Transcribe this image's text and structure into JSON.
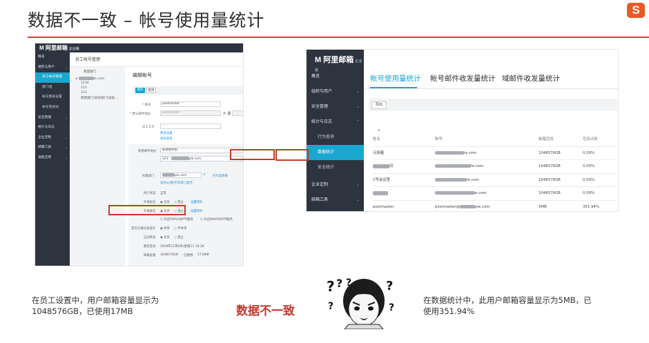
{
  "slide": {
    "title": "数据不一致 – 帐号使用量统计",
    "mid_label": "数据不一致",
    "caption_left": "在员工设置中，用户邮箱容量显示为1048576GB，已使用17MB",
    "caption_right": "在数据统计中，此用户邮箱容量显示为5MB，已使用351.94%",
    "brand_logo": "S",
    "accent_color": "#c8432f",
    "highlight_color": "#c23b22"
  },
  "left_screenshot": {
    "logo": "阿里邮箱",
    "logo_sub": "企业版",
    "sidebar": [
      {
        "label": "概览",
        "sub": false,
        "active": false
      },
      {
        "label": "组织与用户",
        "sub": false,
        "active": false,
        "chev": "⌄"
      },
      {
        "label": "员工帐号管理",
        "sub": true,
        "active": true
      },
      {
        "label": "部门组",
        "sub": true,
        "active": false
      },
      {
        "label": "帐号图表设置",
        "sub": true,
        "active": false
      },
      {
        "label": "帐号回收站",
        "sub": true,
        "active": false
      },
      {
        "label": "安全管理",
        "sub": false,
        "active": false,
        "chev": "⌄"
      },
      {
        "label": "统计与日志",
        "sub": false,
        "active": false,
        "chev": "⌄"
      },
      {
        "label": "企业定制",
        "sub": false,
        "active": false,
        "chev": "⌄"
      },
      {
        "label": "邮箱工具",
        "sub": false,
        "active": false,
        "chev": "⌄"
      },
      {
        "label": "海底应用",
        "sub": false,
        "active": false,
        "chev": "⌄"
      }
    ],
    "breadcrumb": "员工帐号管理",
    "tree": {
      "header": "新建部门",
      "root_suffix": "le.com",
      "items": [
        "1234",
        "123",
        "223",
        "新建部门(如创部门)此处..."
      ]
    },
    "form": {
      "title": "编辑帐号",
      "save_label": "保存",
      "cancel_label": "取消",
      "name_label": "* 姓名",
      "name_value": "postmaster",
      "email_label": "* 默认邮件地址",
      "email_value": "postmaster",
      "email_at": "@",
      "employee_no_label": "员工工号",
      "add_alias_link": "更多设置",
      "more_link": "更多选项",
      "new_email_label": "新建邮件地址",
      "new_email_value": "新建邮件组",
      "new_email_value2": "123 -",
      "new_email_value2_suffix": "ple.com",
      "dept_label": "所属部门",
      "dept_value_suffix": "ple.com",
      "dept_clear": "✕",
      "dept_link1": "打开选择框",
      "dept_link2": "设为公司",
      "dept_link3": "在所有部门显示",
      "status_label": "用户状态",
      "status_value": "正常",
      "send_label": "外域发信",
      "allow_label": "允许",
      "deny_label": "禁止",
      "set_rule_link": "设置例外",
      "receive_label": "外域收信",
      "protocol_pop": "开启POP3/SMTP服务",
      "protocol_imap": "开启IMAP/SMTP服务",
      "share_label": "是否在通讯录显示",
      "share_yes": "共享",
      "share_no": "不共享",
      "forward_label": "自动转发",
      "lastlogin_label": "最后登录",
      "lastlogin_value": "2019年11月8日(星期三) 18:18",
      "quota_label": "邮箱容量",
      "quota_value": "1048576GB",
      "used_label": "已使用:",
      "used_value": "17.6MB"
    }
  },
  "right_screenshot": {
    "logo": "阿里邮箱",
    "logo_sub": "企业版",
    "sidebar": [
      {
        "label": "概览",
        "sub": false,
        "active": false
      },
      {
        "label": "组织与用户",
        "sub": false,
        "active": false,
        "chev": "⌄"
      },
      {
        "label": "安全管理",
        "sub": false,
        "active": false,
        "chev": "⌄"
      },
      {
        "label": "统计与日志",
        "sub": false,
        "active": false,
        "chev": "⌃"
      },
      {
        "label": "行为查询",
        "sub": true,
        "active": false
      },
      {
        "label": "数据统计",
        "sub": true,
        "active": true
      },
      {
        "label": "安全统计",
        "sub": true,
        "active": false
      },
      {
        "label": "企业定制",
        "sub": false,
        "active": false,
        "chev": "⌄"
      },
      {
        "label": "邮箱工具",
        "sub": false,
        "active": false,
        "chev": "⌄"
      }
    ],
    "tabs": [
      "帐号使用量统计",
      "帐号邮件收发量统计",
      "域邮件收发量统计"
    ],
    "export_label": "导出",
    "dot": "•",
    "table": {
      "headers": [
        "姓名",
        "账号",
        "邮箱空间",
        "空间占用"
      ],
      "rows": [
        {
          "name": "元授量",
          "account_suffix": "le.com",
          "space": "1048576GB",
          "usage": "0.00%"
        },
        {
          "name": "",
          "name_suffix": "旧",
          "account_suffix": "le.com",
          "space": "1048576GB",
          "usage": "0.00%"
        },
        {
          "name": "1号会议室",
          "account_suffix": "le.com",
          "space": "1048576GB",
          "usage": "0.00%"
        },
        {
          "name": "",
          "account_suffix": "e.com",
          "space": "1048576GB",
          "usage": "0.00%"
        },
        {
          "name": "postmaster",
          "account_prefix": "postmaster@",
          "account_suffix": "ple.com",
          "space": "5MB",
          "usage": "351.94%"
        }
      ]
    }
  }
}
